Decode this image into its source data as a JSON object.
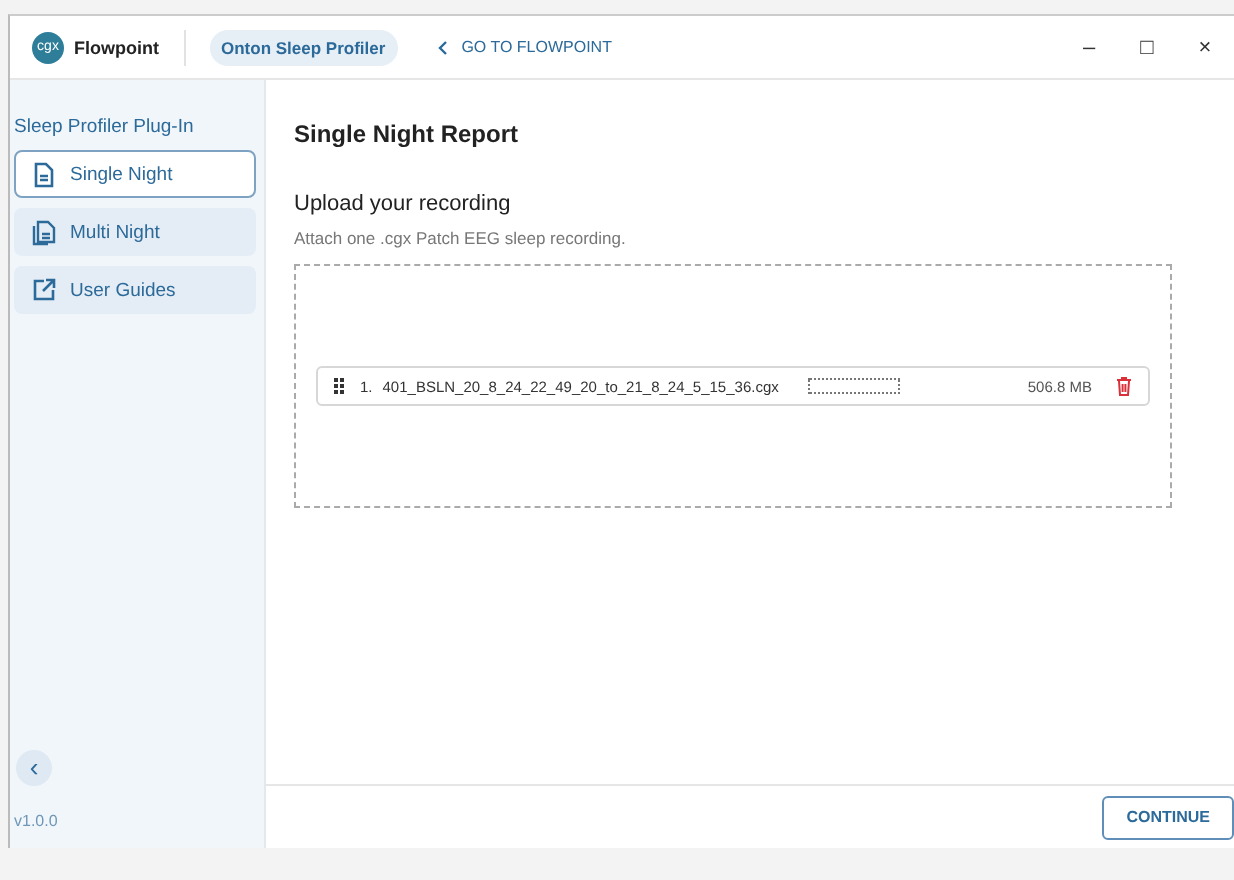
{
  "app": {
    "name": "Flowpoint",
    "logo_text": "cgx",
    "product_badge": "Onton Sleep Profiler",
    "back_link": "GO TO FLOWPOINT"
  },
  "window_controls": [
    "–",
    "□",
    "×"
  ],
  "sidebar": {
    "title": "Sleep Profiler Plug-In",
    "items": [
      {
        "label": "Single Night",
        "selected": true
      },
      {
        "label": "Multi Night",
        "selected": false
      },
      {
        "label": "User Guides",
        "selected": false
      }
    ],
    "collapse_button": "‹",
    "version": "v1.0.0"
  },
  "main": {
    "title": "Single Night Report",
    "section_title": "Upload your recording",
    "hint": "Attach one .cgx Patch EEG sleep recording.",
    "files": [
      {
        "index": "1.",
        "name": "401_BSLN_20_8_24_22_49_20_to_21_8_24_5_15_36.cgx",
        "level": 0,
        "size": "506.8 MB"
      }
    ]
  },
  "footer": {
    "button": "CONTINUE"
  }
}
